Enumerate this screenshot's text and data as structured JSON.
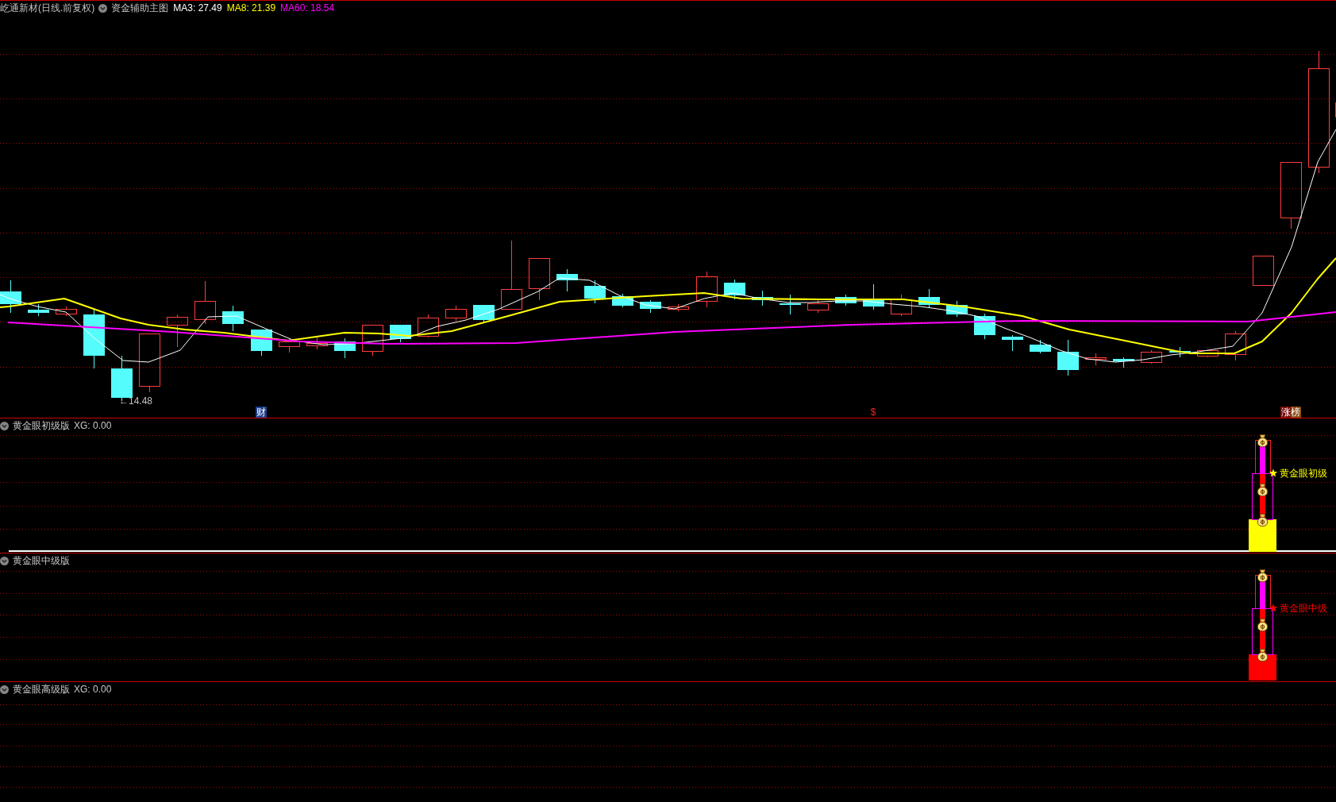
{
  "main_chart": {
    "stock_title": "屹通新材(日线.前复权)",
    "indicator_name": "资金辅助主图",
    "indicators": [
      {
        "label": "MA3: 27.49",
        "color": "#ffffff"
      },
      {
        "label": "MA8: 21.39",
        "color": "#ffff00"
      },
      {
        "label": "MA60: 18.54",
        "color": "#ff00ff"
      }
    ],
    "low_price_label": "←14.48",
    "event_markers": [
      {
        "kind": "finance",
        "label": "财"
      },
      {
        "kind": "dividend",
        "label": "$"
      },
      {
        "kind": "ranking",
        "label": "涨榜"
      }
    ]
  },
  "panels": [
    {
      "title": "黄金眼初级版",
      "value": "XG: 0.00",
      "zero_line": true,
      "signal": {
        "label": "黄金眼初级",
        "color": "#ffff00"
      }
    },
    {
      "title": "黄金眼中级版",
      "zero_line": false,
      "signal": {
        "label": "黄金眼中级",
        "color": "#ff0000"
      }
    },
    {
      "title": "黄金眼高级版",
      "value": "XG: 0.00",
      "zero_line": false
    }
  ]
}
